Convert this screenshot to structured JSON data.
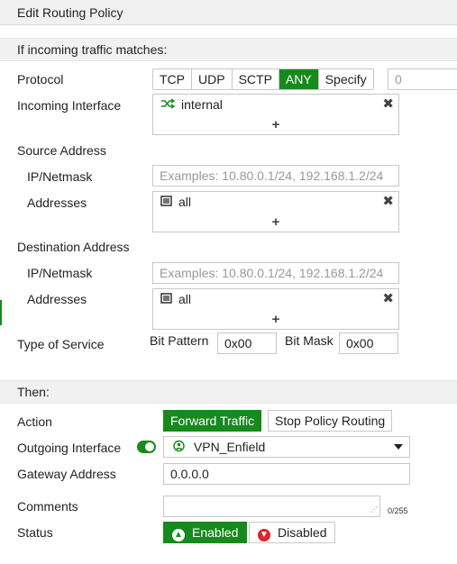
{
  "dialog": {
    "title": "Edit Routing Policy"
  },
  "match_section": {
    "heading": "If incoming traffic matches:",
    "protocol": {
      "label": "Protocol",
      "options": [
        "TCP",
        "UDP",
        "SCTP",
        "ANY",
        "Specify"
      ],
      "selected": "ANY",
      "number_placeholder": "0"
    },
    "incoming_interface": {
      "label": "Incoming Interface",
      "value": "internal"
    },
    "source": {
      "heading": "Source Address",
      "ip_label": "IP/Netmask",
      "ip_placeholder": "Examples: 10.80.0.1/24, 192.168.1.2/24",
      "addresses_label": "Addresses",
      "addresses": [
        "all"
      ]
    },
    "destination": {
      "heading": "Destination Address",
      "ip_label": "IP/Netmask",
      "ip_placeholder": "Examples: 10.80.0.1/24, 192.168.1.2/24",
      "addresses_label": "Addresses",
      "addresses": [
        "all"
      ]
    },
    "tos": {
      "label": "Type of Service",
      "bit_pattern_label": "Bit Pattern",
      "bit_pattern_value": "0x00",
      "bit_mask_label": "Bit Mask",
      "bit_mask_value": "0x00"
    }
  },
  "then_section": {
    "heading": "Then:",
    "action": {
      "label": "Action",
      "options": [
        "Forward Traffic",
        "Stop Policy Routing"
      ],
      "selected": "Forward Traffic"
    },
    "outgoing_interface": {
      "label": "Outgoing Interface",
      "enabled": true,
      "value": "VPN_Enfield"
    },
    "gateway": {
      "label": "Gateway Address",
      "value": "0.0.0.0"
    },
    "comments": {
      "label": "Comments",
      "value": "",
      "counter": "0/255"
    },
    "status": {
      "label": "Status",
      "options": [
        "Enabled",
        "Disabled"
      ],
      "selected": "Enabled"
    }
  },
  "colors": {
    "accent": "#168a1c",
    "disabled_icon": "#d9262c",
    "section_bg": "#f1f1f1"
  },
  "icons": {
    "interface": "shuffle-arrows-icon",
    "address": "address-object-icon",
    "remove": "close-x-icon",
    "add": "plus-icon",
    "outgoing": "vpn-tunnel-icon",
    "enabled": "arrow-up-circle-icon",
    "disabled": "arrow-down-circle-icon"
  }
}
